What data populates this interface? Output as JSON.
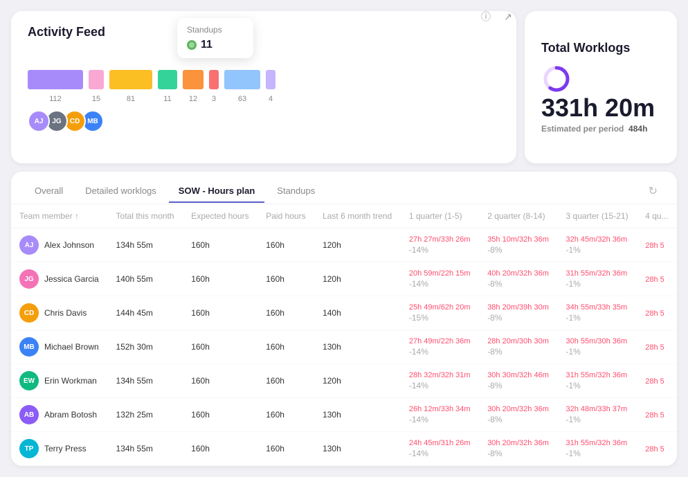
{
  "activity_card": {
    "title": "Activity Feed",
    "bars": [
      {
        "color": "#a78bfa",
        "value": "112",
        "width": 80
      },
      {
        "color": "#f9a8d4",
        "value": "15",
        "width": 22
      },
      {
        "color": "#fbbf24",
        "value": "81",
        "width": 62
      },
      {
        "color": "#34d399",
        "value": "11",
        "width": 28
      },
      {
        "color": "#fb923c",
        "value": "12",
        "width": 30
      },
      {
        "color": "#f87171",
        "value": "3",
        "width": 14
      },
      {
        "color": "#93c5fd",
        "value": "63",
        "width": 52
      },
      {
        "color": "#c4b5fd",
        "value": "4",
        "width": 14
      }
    ],
    "tooltip": {
      "title": "Standups",
      "value": "11",
      "icon_color": "#22c55e"
    },
    "avatars": [
      {
        "color": "#a78bfa",
        "initials": "AJ"
      },
      {
        "color": "#6b7280",
        "initials": "JG"
      },
      {
        "color": "#f59e0b",
        "initials": "CD"
      },
      {
        "color": "#3b82f6",
        "initials": "MB"
      }
    ],
    "info_icon": "ⓘ",
    "expand_icon": "↗"
  },
  "worklogs_card": {
    "title": "Total Worklogs",
    "time": "331h 20m",
    "estimated_label": "Estimated per period",
    "estimated_value": "484h",
    "donut_color": "#7c3aed",
    "donut_bg": "#e9d5ff"
  },
  "table": {
    "tabs": [
      {
        "label": "Overall",
        "active": false
      },
      {
        "label": "Detailed worklogs",
        "active": false
      },
      {
        "label": "SOW - Hours plan",
        "active": true
      },
      {
        "label": "Standups",
        "active": false
      }
    ],
    "columns": [
      "Team member ↑",
      "Total this month",
      "Expected hours",
      "Paid hours",
      "Last 6 month trend",
      "1 quarter (1-5)",
      "2 quarter (8-14)",
      "3 quarter (15-21)",
      "4 qu..."
    ],
    "rows": [
      {
        "name": "Alex Johnson",
        "avatar_color": "#a78bfa",
        "initials": "AJ",
        "total": "134h 55m",
        "expected": "160h",
        "paid": "160h",
        "trend": "120h",
        "q1_hours": "27h 27m/33h 26m",
        "q1_pct": "-14%",
        "q2_hours": "35h 10m/32h 36m",
        "q2_pct": "-8%",
        "q3_hours": "32h 45m/32h 36m",
        "q3_pct": "-1%",
        "q4_hours": "28h 5",
        "q4_pct": ""
      },
      {
        "name": "Jessica Garcia",
        "avatar_color": "#f472b6",
        "initials": "JG",
        "total": "140h 55m",
        "expected": "160h",
        "paid": "160h",
        "trend": "120h",
        "q1_hours": "20h 59m/22h 15m",
        "q1_pct": "-14%",
        "q2_hours": "40h 20m/32h 36m",
        "q2_pct": "-8%",
        "q3_hours": "31h 55m/32h 36m",
        "q3_pct": "-1%",
        "q4_hours": "28h 5",
        "q4_pct": ""
      },
      {
        "name": "Chris Davis",
        "avatar_color": "#f59e0b",
        "initials": "CD",
        "total": "144h 45m",
        "expected": "160h",
        "paid": "160h",
        "trend": "140h",
        "q1_hours": "25h 49m/62h 20m",
        "q1_pct": "-15%",
        "q2_hours": "38h 20m/39h 30m",
        "q2_pct": "-8%",
        "q3_hours": "34h 55m/33h 35m",
        "q3_pct": "-1%",
        "q4_hours": "28h 5",
        "q4_pct": ""
      },
      {
        "name": "Michael Brown",
        "avatar_color": "#3b82f6",
        "initials": "MB",
        "total": "152h 30m",
        "expected": "160h",
        "paid": "160h",
        "trend": "130h",
        "q1_hours": "27h 49m/22h 36m",
        "q1_pct": "-14%",
        "q2_hours": "28h 20m/30h 30m",
        "q2_pct": "-8%",
        "q3_hours": "30h 55m/30h 36m",
        "q3_pct": "-1%",
        "q4_hours": "28h 5",
        "q4_pct": ""
      },
      {
        "name": "Erin Workman",
        "avatar_color": "#10b981",
        "initials": "EW",
        "total": "134h 55m",
        "expected": "160h",
        "paid": "160h",
        "trend": "120h",
        "q1_hours": "28h 32m/32h 31m",
        "q1_pct": "-14%",
        "q2_hours": "30h 30m/32h 46m",
        "q2_pct": "-8%",
        "q3_hours": "31h 55m/32h 36m",
        "q3_pct": "-1%",
        "q4_hours": "28h 5",
        "q4_pct": ""
      },
      {
        "name": "Abram Botosh",
        "avatar_color": "#8b5cf6",
        "initials": "AB",
        "total": "132h 25m",
        "expected": "160h",
        "paid": "160h",
        "trend": "130h",
        "q1_hours": "26h 12m/33h 34m",
        "q1_pct": "-14%",
        "q2_hours": "30h 20m/32h 36m",
        "q2_pct": "-8%",
        "q3_hours": "32h 48m/33h 37m",
        "q3_pct": "-1%",
        "q4_hours": "28h 5",
        "q4_pct": ""
      },
      {
        "name": "Terry Press",
        "avatar_color": "#06b6d4",
        "initials": "TP",
        "total": "134h 55m",
        "expected": "160h",
        "paid": "160h",
        "trend": "130h",
        "q1_hours": "24h 45m/31h 26m",
        "q1_pct": "-14%",
        "q2_hours": "30h 20m/32h 36m",
        "q2_pct": "-8%",
        "q3_hours": "31h 55m/32h 36m",
        "q3_pct": "-1%",
        "q4_hours": "28h 5",
        "q4_pct": ""
      }
    ]
  }
}
